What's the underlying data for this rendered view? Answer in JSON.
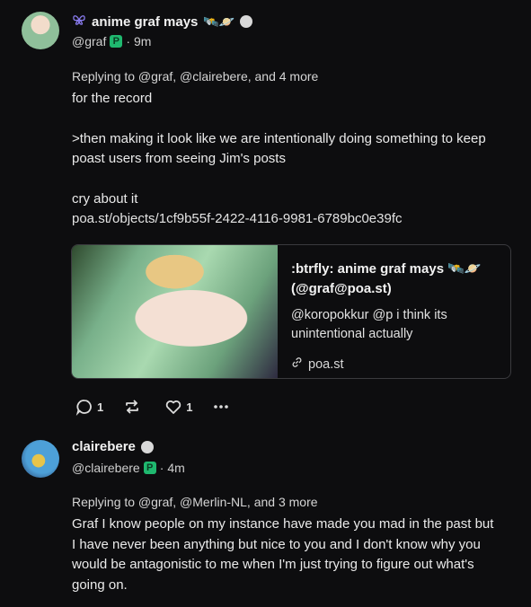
{
  "post1": {
    "display_name": "anime graf mays",
    "name_emojis": "🛰️🪐",
    "handle": "@graf",
    "time": "9m",
    "replying_to": "Replying to @graf, @clairebere, and 4 more",
    "lines": [
      "for the record",
      "",
      ">then making it look like we are intentionally doing something to keep poast users from seeing Jim's posts",
      "",
      "cry about it",
      "poa.st/objects/1cf9b55f-2422-4116-9981-6789bc0e39fc"
    ],
    "card": {
      "title": ":btrfly: anime graf mays 🛰️🪐 (@graf@poa.st)",
      "description": "@koropokkur @p i think its unintentional actually",
      "site": "poa.st"
    },
    "actions": {
      "reply_icon": "reply-icon",
      "reply_count": "1",
      "repeat_icon": "repeat-icon",
      "repeat_count": "",
      "like_icon": "heart-icon",
      "like_count": "1",
      "more_icon": "more-icon"
    }
  },
  "post2": {
    "display_name": "clairebere",
    "handle": "@clairebere",
    "time": "4m",
    "replying_to": "Replying to @graf, @Merlin-NL, and 3 more",
    "text": "Graf I know people on my instance have made you mad in the past but I have never been anything but nice to you and I don't know why you would be antagonistic to me when I'm just trying to figure out what's going on."
  },
  "badge_letter": "P",
  "time_separator": "·",
  "colors": {
    "background": "#0d0d0f",
    "badge_green": "#1fb86f",
    "icon_purple": "#8a7cf0"
  }
}
